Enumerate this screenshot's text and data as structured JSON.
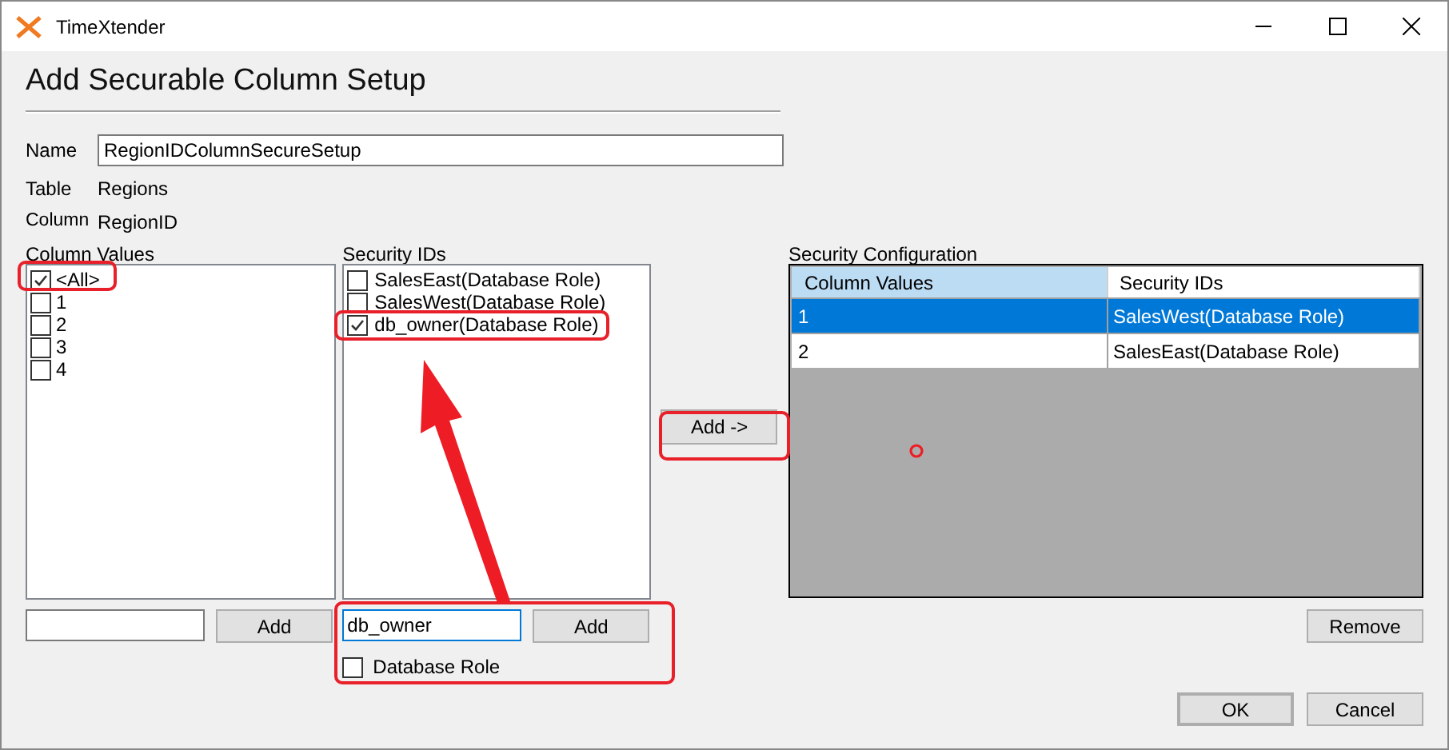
{
  "window": {
    "title": "TimeXtender"
  },
  "heading": "Add Securable Column Setup",
  "name_field": {
    "label": "Name",
    "value": "RegionIDColumnSecureSetup"
  },
  "table": {
    "label": "Table",
    "value": "Regions"
  },
  "column": {
    "label": "Column",
    "value": "RegionID"
  },
  "column_values": {
    "label": "Column Values",
    "add_button": "Add",
    "items": [
      {
        "label": "<All>",
        "checked": true
      },
      {
        "label": "1",
        "checked": false
      },
      {
        "label": "2",
        "checked": false
      },
      {
        "label": "3",
        "checked": false
      },
      {
        "label": "4",
        "checked": false
      }
    ]
  },
  "security_ids": {
    "label": "Security IDs",
    "add_button": "Add",
    "input": {
      "value": "db_owner",
      "focused": true
    },
    "database_role": {
      "label": "Database Role",
      "checked": false
    },
    "items": [
      {
        "label": "SalesEast(Database Role)",
        "checked": false
      },
      {
        "label": "SalesWest(Database Role)",
        "checked": false
      },
      {
        "label": "db_owner(Database Role)",
        "checked": true
      }
    ]
  },
  "add_to_configuration_button": "Add ->",
  "security_configuration": {
    "label": "Security Configuration",
    "columns": [
      {
        "label": "Column Values",
        "selected": true
      },
      {
        "label": "Security IDs",
        "selected": false
      }
    ],
    "rows": [
      {
        "cells": [
          "1",
          "SalesWest(Database Role)"
        ],
        "selected": true
      },
      {
        "cells": [
          "2",
          "SalesEast(Database Role)"
        ],
        "selected": false
      }
    ]
  },
  "remove_button": "Remove",
  "buttons": [
    {
      "label": "OK",
      "default": true
    },
    {
      "label": "Cancel",
      "default": false
    }
  ]
}
